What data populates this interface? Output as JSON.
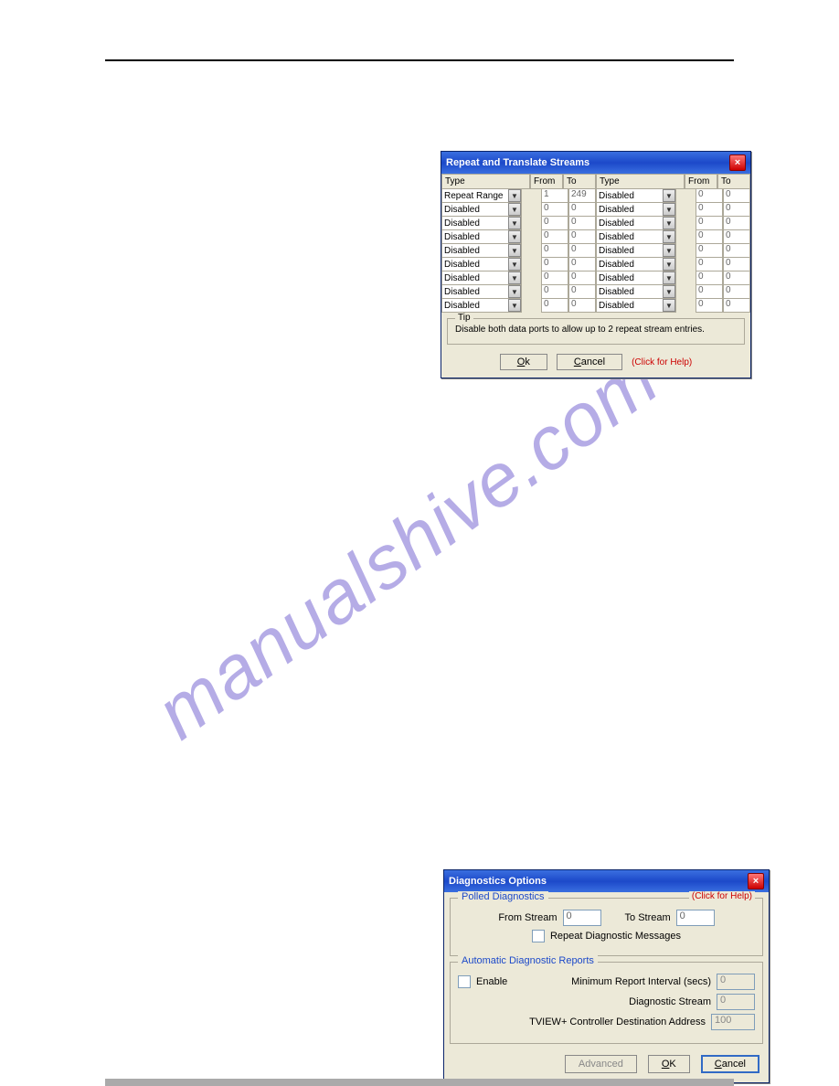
{
  "watermark": "manualshive.com",
  "dialog1": {
    "title": "Repeat and Translate Streams",
    "headers": {
      "type": "Type",
      "from": "From",
      "to": "To"
    },
    "left_rows": [
      {
        "type": "Repeat Range",
        "from": "1",
        "to": "249"
      },
      {
        "type": "Disabled",
        "from": "0",
        "to": "0"
      },
      {
        "type": "Disabled",
        "from": "0",
        "to": "0"
      },
      {
        "type": "Disabled",
        "from": "0",
        "to": "0"
      },
      {
        "type": "Disabled",
        "from": "0",
        "to": "0"
      },
      {
        "type": "Disabled",
        "from": "0",
        "to": "0"
      },
      {
        "type": "Disabled",
        "from": "0",
        "to": "0"
      },
      {
        "type": "Disabled",
        "from": "0",
        "to": "0"
      },
      {
        "type": "Disabled",
        "from": "0",
        "to": "0"
      }
    ],
    "right_rows": [
      {
        "type": "Disabled",
        "from": "0",
        "to": "0"
      },
      {
        "type": "Disabled",
        "from": "0",
        "to": "0"
      },
      {
        "type": "Disabled",
        "from": "0",
        "to": "0"
      },
      {
        "type": "Disabled",
        "from": "0",
        "to": "0"
      },
      {
        "type": "Disabled",
        "from": "0",
        "to": "0"
      },
      {
        "type": "Disabled",
        "from": "0",
        "to": "0"
      },
      {
        "type": "Disabled",
        "from": "0",
        "to": "0"
      },
      {
        "type": "Disabled",
        "from": "0",
        "to": "0"
      },
      {
        "type": "Disabled",
        "from": "0",
        "to": "0"
      }
    ],
    "tip_label": "Tip",
    "tip_text": "Disable both data ports to allow up to 2 repeat stream entries.",
    "ok_u": "O",
    "ok_rest": "k",
    "cancel_u": "C",
    "cancel_rest": "ancel",
    "help": "(Click for Help)"
  },
  "dialog2": {
    "title": "Diagnostics Options",
    "help": "(Click for Help)",
    "polled": {
      "legend": "Polled Diagnostics",
      "from_label": "From Stream",
      "from_value": "0",
      "to_label": "To Stream",
      "to_value": "0",
      "repeat_label": "Repeat Diagnostic Messages"
    },
    "auto": {
      "legend": "Automatic Diagnostic Reports",
      "enable_label": "Enable",
      "min_interval_label": "Minimum Report Interval (secs)",
      "min_interval_value": "0",
      "diag_stream_label": "Diagnostic Stream",
      "diag_stream_value": "0",
      "dest_addr_label": "TVIEW+ Controller Destination Address",
      "dest_addr_value": "100"
    },
    "buttons": {
      "advanced": "Advanced",
      "ok_u": "O",
      "ok_rest": "K",
      "cancel_u": "C",
      "cancel_rest": "ancel"
    }
  }
}
